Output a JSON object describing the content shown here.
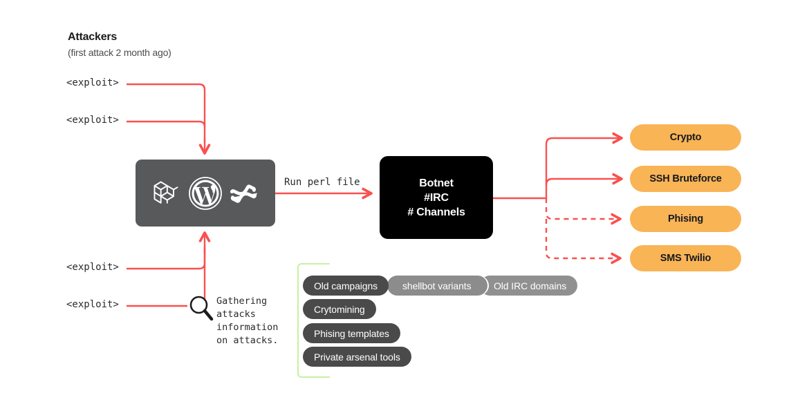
{
  "header": {
    "title": "Attackers",
    "subtitle": "(first attack 2 month ago)"
  },
  "exploits": [
    {
      "label": "<exploit>"
    },
    {
      "label": "<exploit>"
    },
    {
      "label": "<exploit>"
    },
    {
      "label": "<exploit>"
    }
  ],
  "cms_box": {
    "name": "compromised-cms-targets",
    "icons": [
      "laravel-icon",
      "wordpress-icon",
      "confluence-icon"
    ],
    "background": "#58595b"
  },
  "edge_labels": {
    "run_perl": "Run perl file",
    "gathering": "Gathering\nattacks\ninformation\non attacks."
  },
  "botnet": {
    "text": "Botnet\n#IRC\n# Channels",
    "background": "#000000"
  },
  "outcomes": [
    {
      "label": "Crypto",
      "line": "solid"
    },
    {
      "label": "SSH Bruteforce",
      "line": "solid"
    },
    {
      "label": "Phising",
      "line": "dashed"
    },
    {
      "label": "SMS Twilio",
      "line": "dashed"
    }
  ],
  "intel_tags": {
    "row1": [
      {
        "label": "Old campaigns",
        "shade": "dark"
      },
      {
        "label": "shellbot variants",
        "shade": "mid"
      },
      {
        "label": "Old IRC domains",
        "shade": "mid"
      }
    ],
    "rows": [
      {
        "label": "Crytomining",
        "shade": "dark"
      },
      {
        "label": "Phising templates",
        "shade": "dark"
      },
      {
        "label": "Private arsenal tools",
        "shade": "dark"
      }
    ]
  },
  "colors": {
    "arrow_red": "#f9504f",
    "orange": "#f9b456",
    "gray_box": "#58595b",
    "tag_dark": "#4a4a4a",
    "tag_mid": "#8c8c8c",
    "green_bracket": "#c9efa4",
    "black_box": "#000000"
  }
}
